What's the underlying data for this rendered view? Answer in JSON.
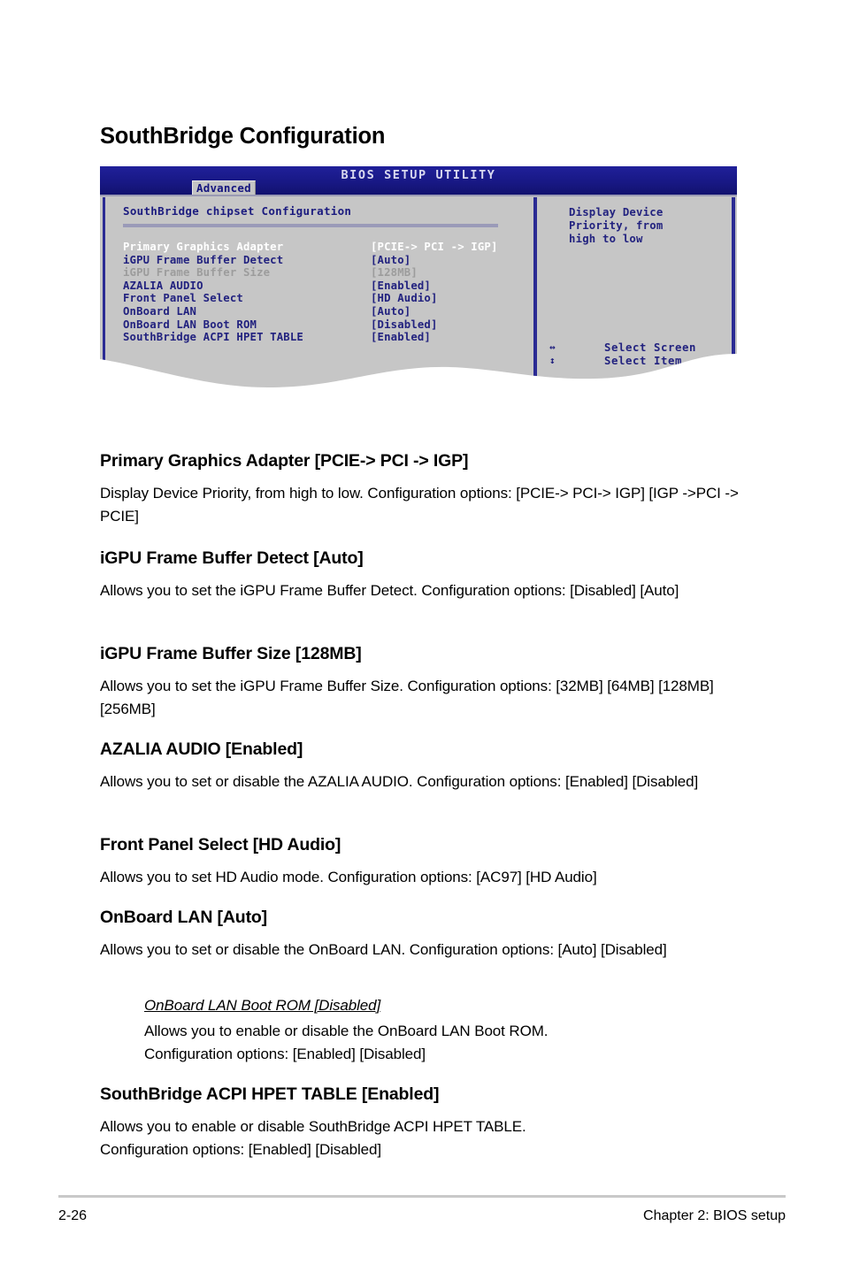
{
  "page": {
    "section_title": "SouthBridge Configuration",
    "footer_page_number": "2-26",
    "footer_chapter": "Chapter 2: BIOS setup"
  },
  "bios_screen": {
    "title": "BIOS SETUP UTILITY",
    "active_tab": "Advanced",
    "panel_heading": "SouthBridge chipset Configuration",
    "rows": [
      {
        "label": "Primary Graphics Adapter",
        "value": "[PCIE-> PCI -> IGP]",
        "state": "selected"
      },
      {
        "label": "iGPU Frame Buffer Detect",
        "value": "[Auto]",
        "state": "normal"
      },
      {
        "label": "iGPU Frame Buffer Size",
        "value": "[128MB]",
        "state": "dim"
      },
      {
        "label": "AZALIA AUDIO",
        "value": "[Enabled]",
        "state": "normal"
      },
      {
        "label": "Front Panel Select",
        "value": "[HD Audio]",
        "state": "normal"
      },
      {
        "label": "OnBoard LAN",
        "value": "[Auto]",
        "state": "normal"
      },
      {
        "label": " OnBoard LAN Boot ROM",
        "value": "[Disabled]",
        "state": "normal"
      },
      {
        "label": "SouthBridge ACPI HPET TABLE",
        "value": "[Enabled]",
        "state": "normal"
      }
    ],
    "help_text": "Display Device\nPriority, from\nhigh to low",
    "nav": [
      {
        "keys": "↔",
        "action": "Select Screen"
      },
      {
        "keys": "↕",
        "action": "Select Item"
      }
    ],
    "colors": {
      "titlebar": "#181885",
      "panel_bg": "#c6c6c6",
      "frame": "#2a2a93",
      "text": "#22227f",
      "text_dim": "#9c9c9c",
      "text_selected": "#ffffff"
    }
  },
  "sections": [
    {
      "heading": "Primary Graphics Adapter [PCIE-> PCI -> IGP]",
      "body": "Display Device Priority, from high to low. Configuration options: [PCIE-> PCI-> IGP] [IGP ->PCI -> PCIE]"
    },
    {
      "heading": "iGPU Frame Buffer Detect [Auto]",
      "body": "Allows you to set the iGPU Frame Buffer Detect. Configuration options: [Disabled] [Auto]"
    },
    {
      "heading": "iGPU Frame Buffer Size [128MB]",
      "body": "Allows you to set the iGPU Frame Buffer Size. Configuration options: [32MB] [64MB] [128MB] [256MB]"
    },
    {
      "heading": "AZALIA AUDIO [Enabled]",
      "body": "Allows you to set or disable the AZALIA AUDIO. Configuration options: [Enabled] [Disabled]"
    },
    {
      "heading": "Front Panel Select [HD Audio]",
      "body": "Allows you to set HD Audio mode. Configuration options: [AC97] [HD Audio]"
    },
    {
      "heading": "OnBoard LAN [Auto]",
      "body": "Allows you to set or disable the OnBoard LAN. Configuration options: [Auto] [Disabled]",
      "sub_heading": "OnBoard LAN Boot ROM [Disabled]",
      "sub_body": "Allows you to enable or disable the OnBoard LAN Boot ROM.\nConfiguration options: [Enabled] [Disabled]"
    },
    {
      "heading": "SouthBridge ACPI HPET TABLE [Enabled]",
      "body": "Allows you to enable or disable SouthBridge ACPI HPET TABLE.\nConfiguration options: [Enabled] [Disabled]"
    }
  ]
}
